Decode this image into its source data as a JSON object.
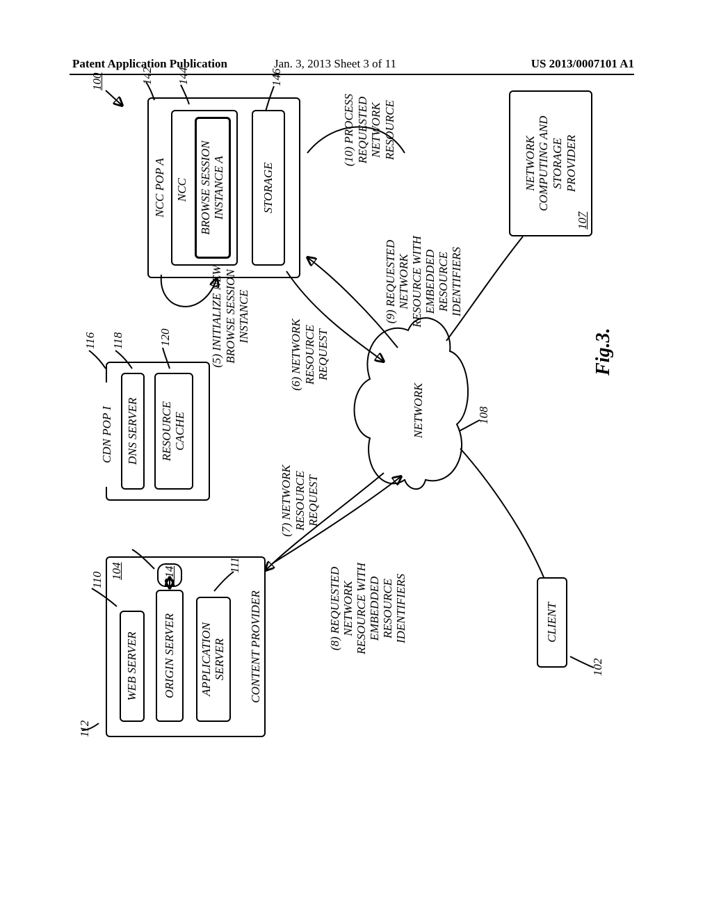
{
  "header": {
    "left": "Patent Application Publication",
    "mid": "Jan. 3, 2013   Sheet 3 of 11",
    "right": "US 2013/0007101 A1"
  },
  "refs": {
    "r100": "100",
    "r102": "102",
    "r104": "104",
    "r107": "107",
    "r108": "108",
    "r110": "110",
    "r111": "111",
    "r112": "112",
    "r114": "114",
    "r116": "116",
    "r118": "118",
    "r120": "120",
    "r142": "142",
    "r144": "144",
    "r146": "146"
  },
  "boxes": {
    "web_server": "WEB SERVER",
    "origin_server": "ORIGIN SERVER",
    "app_server": "APPLICATION\nSERVER",
    "content_provider": "CONTENT PROVIDER",
    "cdn_pop": "CDN POP I",
    "dns_server": "DNS SERVER",
    "resource_cache": "RESOURCE\nCACHE",
    "ncc_pop": "NCC POP A",
    "ncc": "NCC",
    "browse_session": "BROWSE SESSION\nINSTANCE A",
    "storage": "STORAGE",
    "client": "CLIENT",
    "ncsp": "NETWORK\nCOMPUTING AND\nSTORAGE\nPROVIDER",
    "network": "NETWORK"
  },
  "flows": {
    "f5": "(5) INITIALIZE NEW\nBROWSE SESSION\nINSTANCE",
    "f6": "(6) NETWORK\nRESOURCE\nREQUEST",
    "f7": "(7) NETWORK\nRESOURCE\nREQUEST",
    "f8": "(8) REQUESTED\nNETWORK\nRESOURCE WITH\nEMBEDDED\nRESOURCE\nIDENTIFIERS",
    "f9": "(9) REQUESTED\nNETWORK\nRESOURCE WITH\nEMBEDDED\nRESOURCE\nIDENTIFIERS",
    "f10": "(10) PROCESS\nREQUESTED\nNETWORK\nRESOURCE"
  },
  "figure_caption": "Fig.3."
}
